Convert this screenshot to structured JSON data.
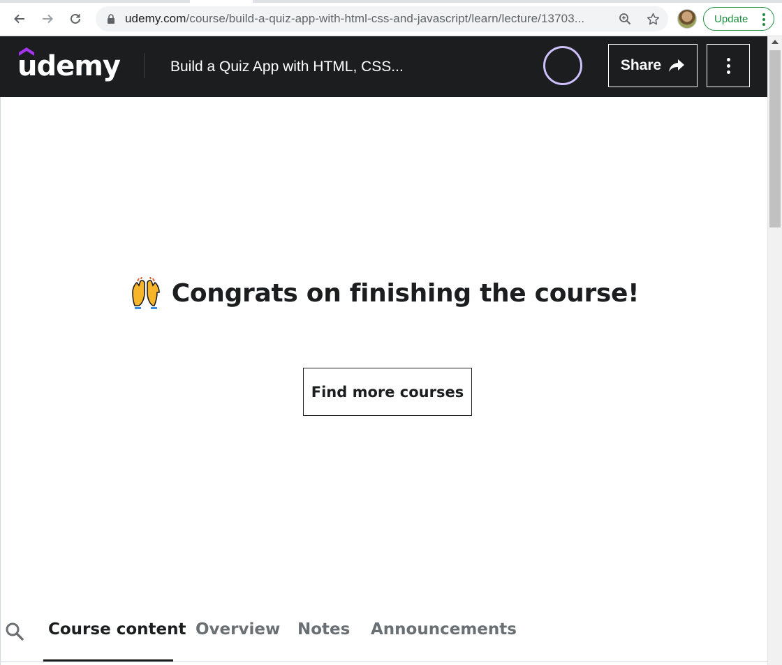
{
  "browser": {
    "url_host": "udemy.com",
    "url_path": "/course/build-a-quiz-app-with-html-css-and-javascript/learn/lecture/13703...",
    "update_label": "Update",
    "icons": [
      "back-icon",
      "forward-icon",
      "reload-icon",
      "lock-icon",
      "zoom-icon",
      "star-icon",
      "profile-avatar",
      "menu-dots-icon"
    ]
  },
  "header": {
    "logo_text": "udemy",
    "course_title": "Build a Quiz App with HTML, CSS...",
    "share_label": "Share",
    "brand_color": "#a435f0",
    "progress_ring_color": "#cec0fc"
  },
  "main": {
    "congrats_emoji": "raising-hands-icon",
    "congrats_text": "Congrats on finishing the course!",
    "find_courses_label": "Find more courses"
  },
  "tabs": {
    "items": [
      {
        "label": "Course content",
        "active": true
      },
      {
        "label": "Overview",
        "active": false
      },
      {
        "label": "Notes",
        "active": false
      },
      {
        "label": "Announcements",
        "active": false
      }
    ]
  }
}
